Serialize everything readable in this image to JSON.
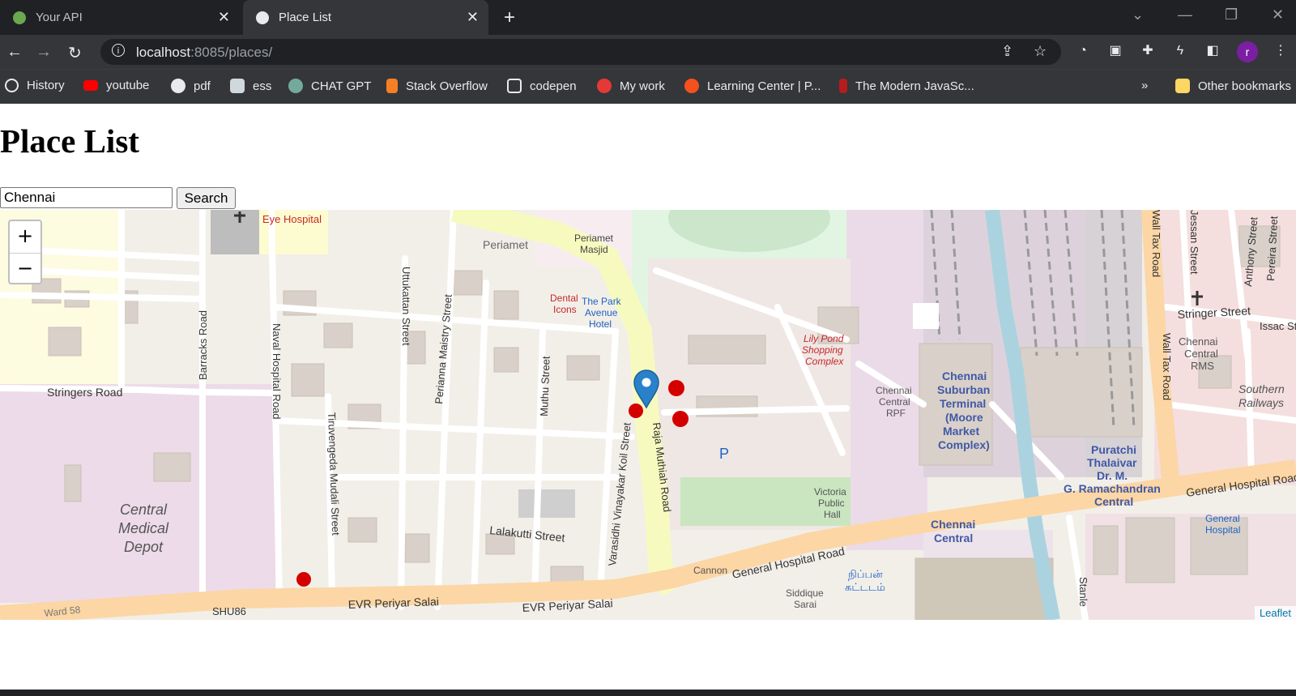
{
  "browser": {
    "tabs": [
      {
        "title": "Your API"
      },
      {
        "title": "Place List"
      }
    ],
    "url_host": "localhost",
    "url_rest": ":8085/places/",
    "profile_initial": "r",
    "bookmarks": [
      {
        "label": "History"
      },
      {
        "label": "youtube"
      },
      {
        "label": "pdf"
      },
      {
        "label": "ess"
      },
      {
        "label": "CHAT GPT"
      },
      {
        "label": "Stack Overflow"
      },
      {
        "label": "codepen"
      },
      {
        "label": "My work"
      },
      {
        "label": "Learning Center | P..."
      },
      {
        "label": "The Modern JavaSc..."
      }
    ],
    "more_bookmarks": "»",
    "other_bookmarks": "Other bookmarks"
  },
  "page": {
    "title": "Place List",
    "search_value": "Chennai",
    "search_button": "Search"
  },
  "map": {
    "zoom_in": "+",
    "zoom_out": "−",
    "attribution": "Leaflet",
    "labels": {
      "eye_hospital": "Eye Hospital",
      "periamet": "Periamet",
      "periamet_masjid_1": "Periamet",
      "periamet_masjid_2": "Masjid",
      "dental_1": "Dental",
      "dental_2": "Icons",
      "park_1": "The Park",
      "park_2": "Avenue",
      "park_3": "Hotel",
      "stringers_road": "Stringers Road",
      "barracks_road": "Barracks Road",
      "naval_hospital_road": "Naval Hospital Road",
      "uttukattan_street": "Uttukattan Street",
      "perianna_maistry_street": "Perianna Maistry Street",
      "muthu_street": "Muthu Street",
      "tiruvengeda_mudali_street": "Tiruvengeda Mudali Street",
      "varasidhi_street": "Varasidhi Vinayakar Koil Street",
      "raja_muthiah_road": "Raja Muthiah Road",
      "lalakutti_street": "Lalakutti Street",
      "central_1": "Central",
      "central_2": "Medical",
      "central_3": "Depot",
      "evr_1": "EVR Periyar Salai",
      "evr_2": "EVR Periyar Salai",
      "ward_58": "Ward 58",
      "shu86": "SHU86",
      "lily_1": "Lily Pond",
      "lily_2": "Shopping",
      "lily_3": "Complex",
      "rpf_1": "Chennai",
      "rpf_2": "Central",
      "rpf_3": "RPF",
      "suburban_1": "Chennai",
      "suburban_2": "Suburban",
      "suburban_3": "Terminal",
      "suburban_4": "(Moore",
      "suburban_5": "Market",
      "suburban_6": "Complex)",
      "puratchi_1": "Puratchi",
      "puratchi_2": "Thalaivar",
      "puratchi_3": "Dr. M.",
      "puratchi_4": "G. Ramachandran",
      "puratchi_5": "Central",
      "victoria_1": "Victoria",
      "victoria_2": "Public",
      "victoria_3": "Hall",
      "chennai_central_1": "Chennai",
      "chennai_central_2": "Central",
      "cannon": "Cannon",
      "ghr_1": "General Hospital Road",
      "ghr_2": "General Hospital Road",
      "siddique_1": "Siddique",
      "siddique_2": "Sarai",
      "tamil_1": "நிப்பன்",
      "tamil_2": "கட்டடம்",
      "stringer_street": "Stringer Street",
      "issac": "Issac St",
      "crms_1": "Chennai",
      "crms_2": "Central",
      "crms_3": "RMS",
      "southern_1": "Southern",
      "southern_2": "Railways",
      "wall_tax_1": "Wall Tax Road",
      "wall_tax_2": "Wall Tax Road",
      "jessan": "Jessan Street",
      "anthony": "Anthony Street",
      "pereira": "Pereira Street",
      "gen_hosp_1": "General",
      "gen_hosp_2": "Hospital",
      "stanley": "Stanle",
      "parking": "P"
    }
  }
}
